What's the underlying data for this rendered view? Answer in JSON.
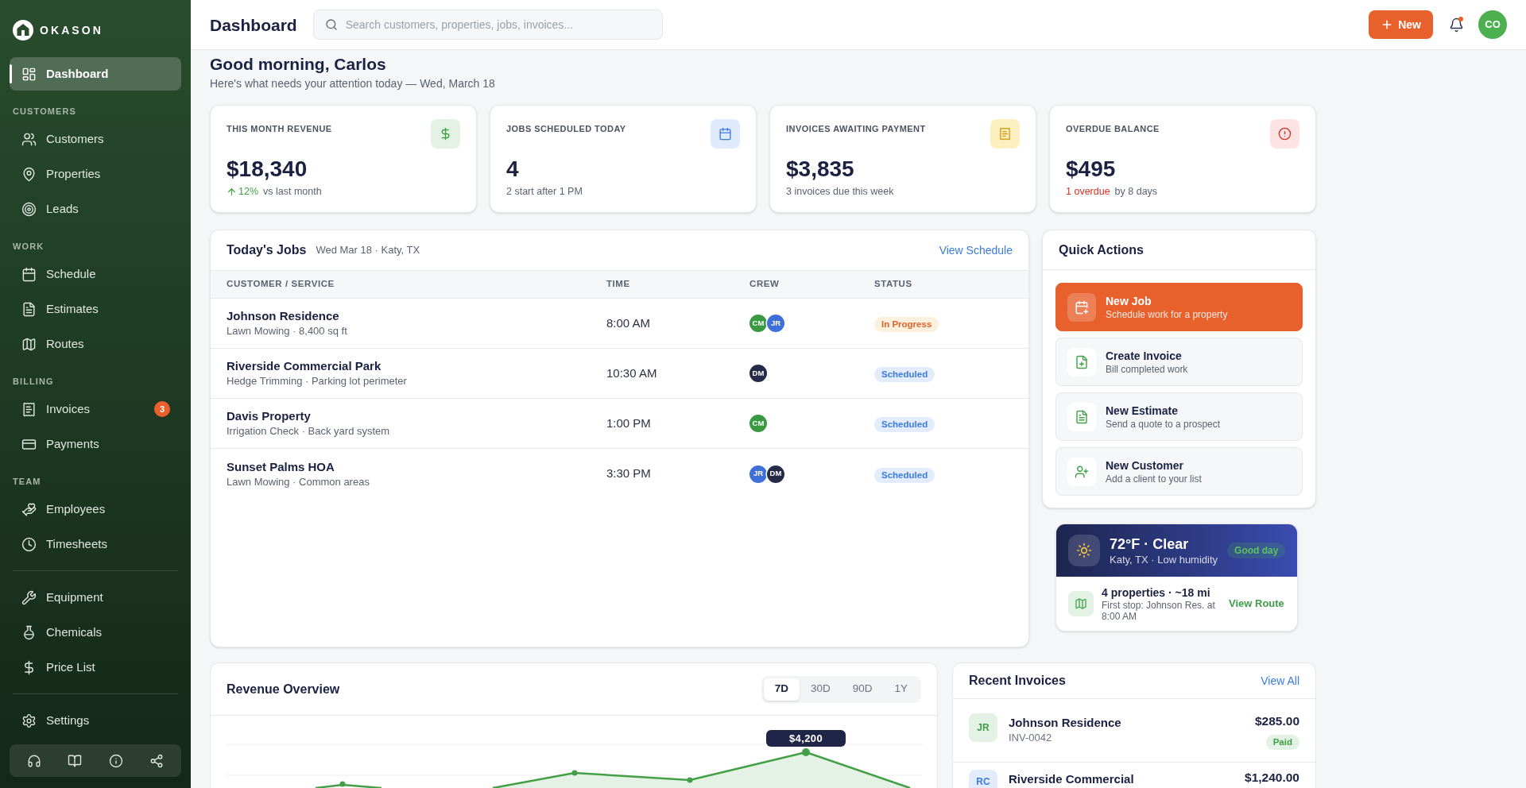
{
  "sidebar": {
    "brand": "OKASON",
    "groups": [
      {
        "items": [
          {
            "label": "Dashboard",
            "selected": true
          }
        ]
      },
      {
        "title": "CUSTOMERS",
        "items": [
          {
            "label": "Customers",
            "selected": false
          },
          {
            "label": "Properties",
            "selected": false
          },
          {
            "label": "Leads",
            "selected": false
          }
        ]
      },
      {
        "title": "WORK",
        "items": [
          {
            "label": "Schedule",
            "selected": false
          },
          {
            "label": "Estimates",
            "selected": false
          },
          {
            "label": "Routes",
            "selected": false
          }
        ]
      },
      {
        "title": "BILLING",
        "items": [
          {
            "label": "Invoices",
            "selected": false,
            "badge": "3"
          },
          {
            "label": "Payments",
            "selected": false
          }
        ]
      },
      {
        "title": "TEAM",
        "items": [
          {
            "label": "Employees",
            "selected": false
          },
          {
            "label": "Timesheets",
            "selected": false
          }
        ]
      },
      {
        "items": [
          {
            "label": "Equipment",
            "selected": false
          },
          {
            "label": "Chemicals",
            "selected": false
          },
          {
            "label": "Price List",
            "selected": false
          }
        ]
      },
      {
        "items": [
          {
            "label": "Settings",
            "selected": false
          }
        ]
      }
    ]
  },
  "topbar": {
    "title": "Dashboard",
    "search": {
      "placeholder": "Search customers, properties, jobs, invoices..."
    },
    "new_button": "New",
    "has_unread": true,
    "avatar": "CO"
  },
  "greeting": {
    "title": "Good morning, Carlos",
    "subtitle": "Here's what needs your attention today — Wed, March 18"
  },
  "stats": [
    {
      "label": "THIS MONTH REVENUE",
      "value": "$18,340",
      "trend": {
        "kind": "up",
        "text": "12%"
      },
      "note": "vs last month"
    },
    {
      "label": "JOBS SCHEDULED TODAY",
      "value": "4",
      "note": "2 start after 1 PM"
    },
    {
      "label": "INVOICES AWAITING PAYMENT",
      "value": "$3,835",
      "note": "3 invoices due this week"
    },
    {
      "label": "OVERDUE BALANCE",
      "value": "$495",
      "trend": {
        "kind": "alert",
        "text": "1 overdue"
      },
      "note": "by 8 days"
    }
  ],
  "jobs": {
    "title": "Today's Jobs",
    "subtitle": "Wed Mar 18 · Katy, TX",
    "link": "View Schedule",
    "columns": [
      "CUSTOMER / SERVICE",
      "TIME",
      "CREW",
      "STATUS"
    ],
    "rows": [
      {
        "customer": "Johnson Residence",
        "service": "Lawn Mowing · 8,400 sq ft",
        "time": "8:00 AM",
        "crew": [
          {
            "initials": "CM",
            "color": "#3a9a44"
          },
          {
            "initials": "JR",
            "color": "#3f6fd8"
          }
        ],
        "status": {
          "kind": "in_progress",
          "text": "In Progress"
        }
      },
      {
        "customer": "Riverside Commercial Park",
        "service": "Hedge Trimming · Parking lot perimeter",
        "time": "10:30 AM",
        "crew": [
          {
            "initials": "DM",
            "color": "#262c48"
          }
        ],
        "status": {
          "kind": "scheduled",
          "text": "Scheduled"
        }
      },
      {
        "customer": "Davis Property",
        "service": "Irrigation Check · Back yard system",
        "time": "1:00 PM",
        "crew": [
          {
            "initials": "CM",
            "color": "#3a9a44"
          }
        ],
        "status": {
          "kind": "scheduled",
          "text": "Scheduled"
        }
      },
      {
        "customer": "Sunset Palms HOA",
        "service": "Lawn Mowing · Common areas",
        "time": "3:30 PM",
        "crew": [
          {
            "initials": "JR",
            "color": "#3f6fd8"
          },
          {
            "initials": "DM",
            "color": "#262c48"
          }
        ],
        "status": {
          "kind": "scheduled",
          "text": "Scheduled"
        }
      }
    ]
  },
  "quick_actions": {
    "title": "Quick Actions",
    "items": [
      {
        "kind": "primary",
        "title": "New Job",
        "subtitle": "Schedule work for a property"
      },
      {
        "kind": "secondary",
        "title": "Create Invoice",
        "subtitle": "Bill completed work"
      },
      {
        "kind": "secondary",
        "title": "New Estimate",
        "subtitle": "Send a quote to a prospect"
      },
      {
        "kind": "secondary",
        "title": "New Customer",
        "subtitle": "Add a client to your list"
      }
    ]
  },
  "weather": {
    "title": "72°F · Clear",
    "location": "Katy, TX · Low humidity",
    "badge": "Good day",
    "route": {
      "summary": "4 properties · ~18 mi",
      "detail": "First stop: Johnson Res. at 8:00 AM",
      "link": "View Route"
    }
  },
  "revenue": {
    "title": "Revenue Overview",
    "ranges": [
      {
        "label": "7D",
        "selected": true
      },
      {
        "label": "30D",
        "selected": false
      },
      {
        "label": "90D",
        "selected": false
      },
      {
        "label": "1Y",
        "selected": false
      }
    ],
    "tooltip": "$4,200"
  },
  "invoices": {
    "title": "Recent Invoices",
    "link": "View All",
    "rows": [
      {
        "initials": "JR",
        "color": "#3f9e47",
        "customer": "Johnson Residence",
        "number": "INV-0042",
        "amount": "$285.00",
        "status": {
          "kind": "paid",
          "text": "Paid"
        }
      },
      {
        "initials": "RC",
        "color": "#3b7be0",
        "customer": "Riverside Commercial",
        "amount": "$1,240.00"
      }
    ]
  }
}
